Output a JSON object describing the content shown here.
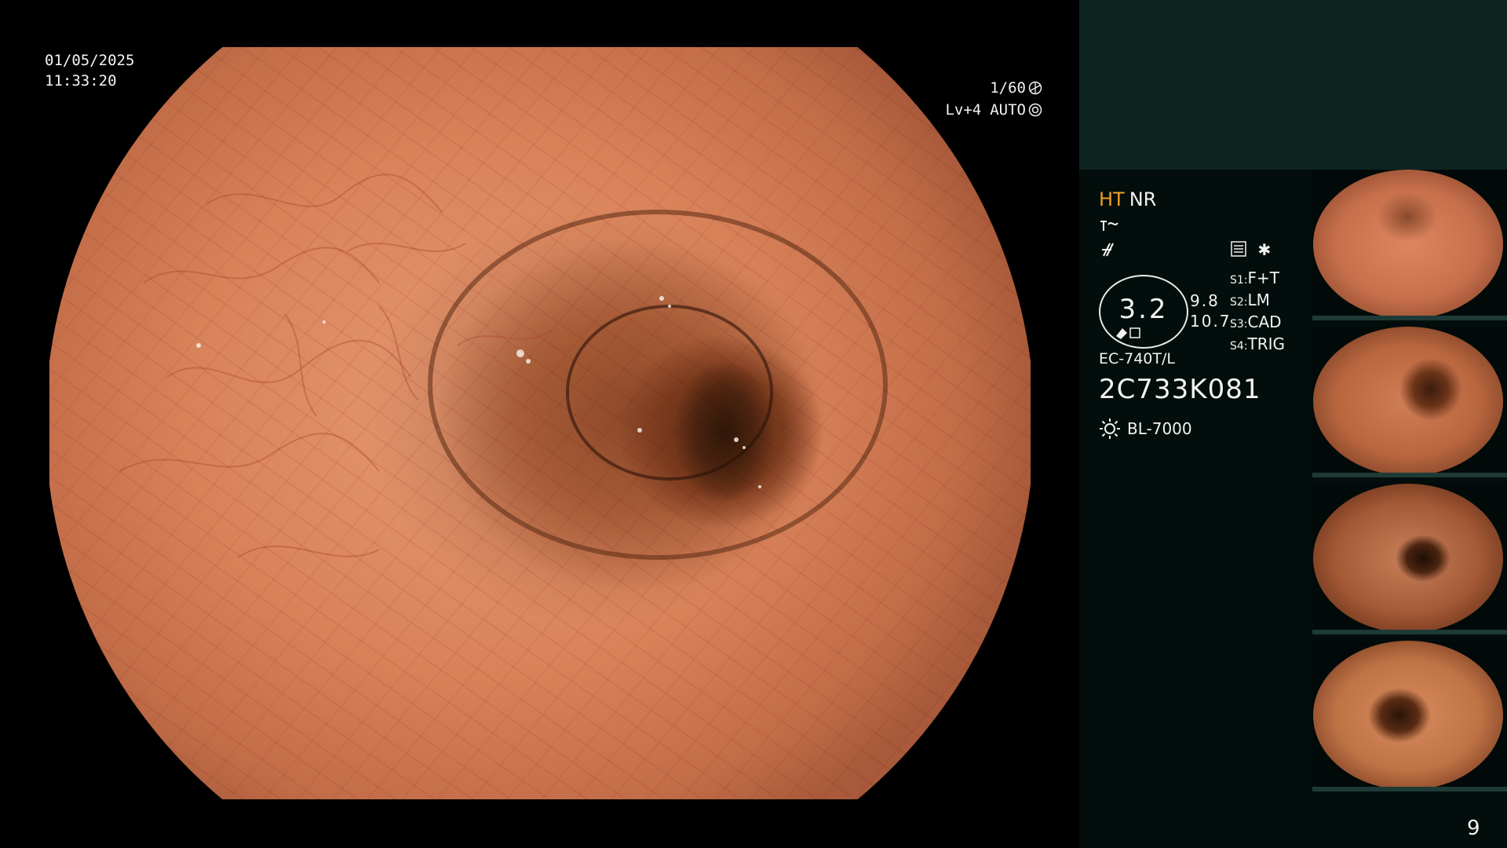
{
  "overlay": {
    "date": "01/05/2025",
    "time": "11:33:20",
    "shutter": "1/60",
    "level": "Lv+4",
    "mode": "AUTO"
  },
  "image_modes": {
    "ht": "HT",
    "nr": "NR"
  },
  "zoom": {
    "magnification": "3.2",
    "value_top": "9.8",
    "value_bottom": "10.7"
  },
  "scope": {
    "model": "EC-740T/L",
    "serial": "2C733K081"
  },
  "light_source": {
    "name": "BL-7000",
    "icon": "lamp-icon"
  },
  "switches": [
    {
      "key": "S1:",
      "value": "F+T"
    },
    {
      "key": "S2:",
      "value": "LM"
    },
    {
      "key": "S3:",
      "value": "CAD"
    },
    {
      "key": "S4:",
      "value": "TRIG"
    }
  ],
  "switch_icons": [
    "memory-card-icon",
    "asterisk-icon"
  ],
  "thumbnails": [
    {
      "name": "captured-frame-1",
      "tint": "#c8704c"
    },
    {
      "name": "captured-frame-2",
      "tint": "#b9663f"
    },
    {
      "name": "captured-frame-3",
      "tint": "#a55a36"
    },
    {
      "name": "captured-frame-4",
      "tint": "#c07446"
    }
  ],
  "page_number": "9",
  "colors": {
    "panel_bg": "#030e0c",
    "panel_top": "#0e2421",
    "ht_accent": "#f0a020",
    "mucosa": "#d8825a"
  }
}
